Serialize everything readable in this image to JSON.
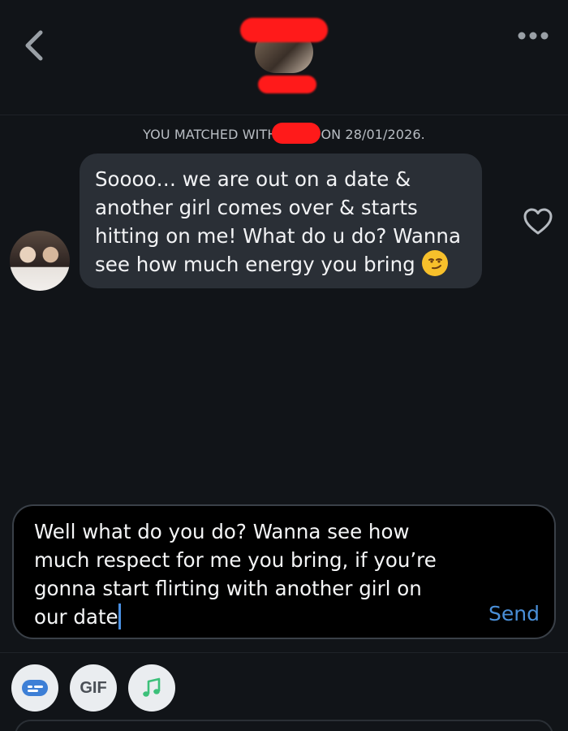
{
  "header": {
    "back_icon": "chevron-left-icon",
    "more_icon": "ellipsis-icon"
  },
  "match_notice": {
    "prefix": "YOU MATCHED WITH",
    "suffix": "ON 28/01/2026."
  },
  "message": {
    "lines": [
      "Soooo… we are out on a date &",
      "another girl comes over & starts",
      "hitting on me! What do u do? Wanna",
      "see how much energy you bring"
    ],
    "emoji": "smirking-face"
  },
  "composer": {
    "lines": [
      "Well what do you do? Wanna see how",
      "much respect for me you bring, if you’re",
      "gonna start flirting with another girl on",
      "our date"
    ],
    "send_label": "Send"
  },
  "tools": {
    "gif_label": "GIF"
  },
  "colors": {
    "background": "#111418",
    "bubble": "#2a2f36",
    "accent": "#4a8fd8",
    "redaction": "#ff1a1a"
  }
}
